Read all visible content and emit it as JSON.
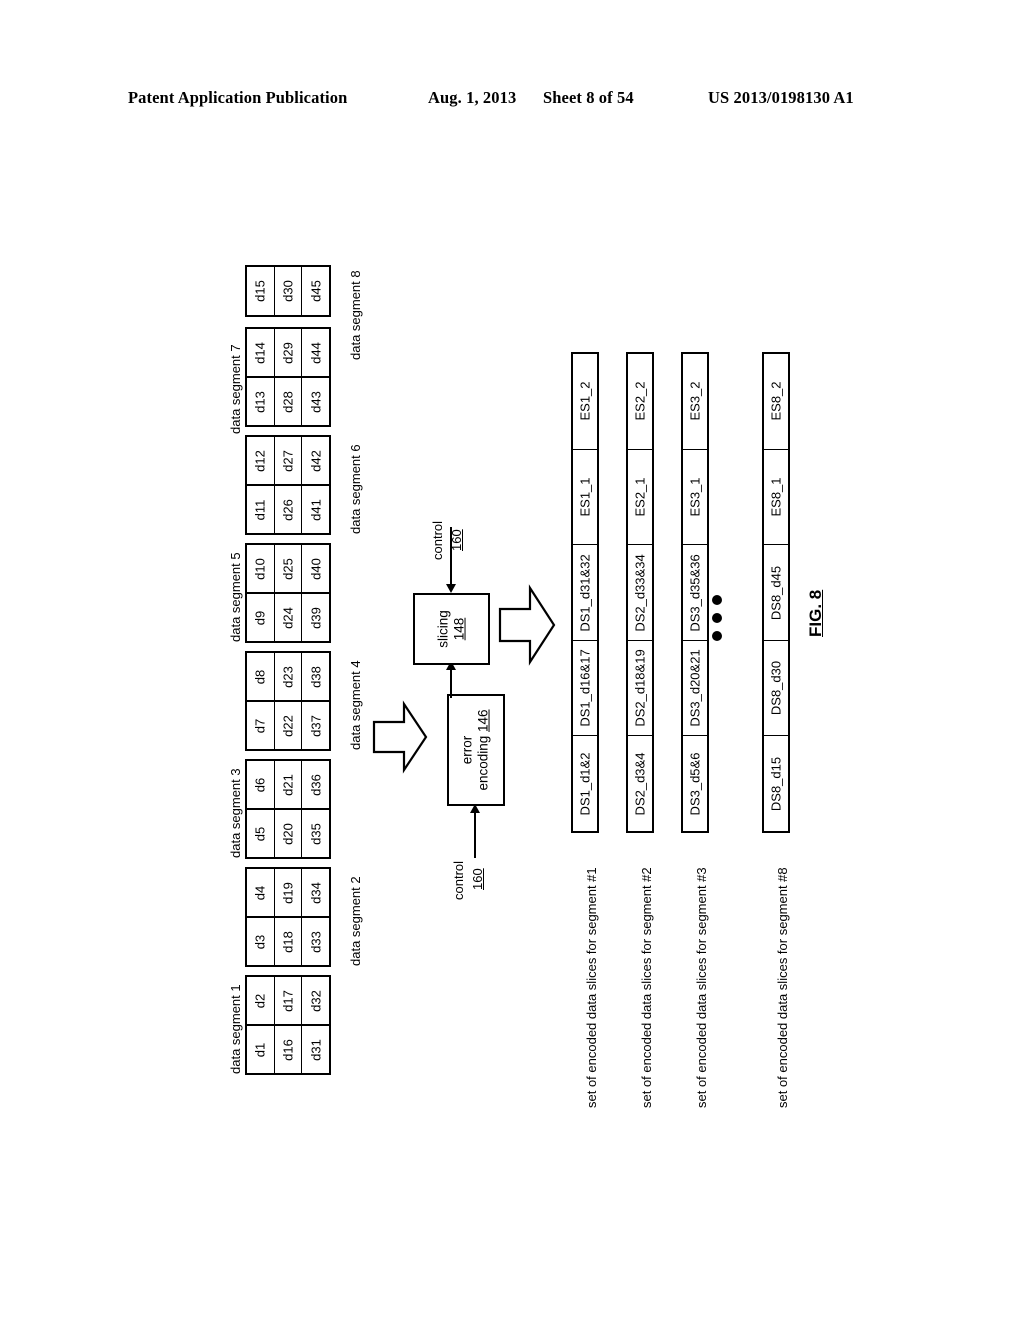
{
  "header": {
    "publication": "Patent Application Publication",
    "date": "Aug. 1, 2013",
    "sheet": "Sheet 8 of 54",
    "patent_number": "US 2013/0198130 A1"
  },
  "figure": {
    "caption": "FIG. 8"
  },
  "data_segments": [
    {
      "label": "data segment 1",
      "label_side": "left",
      "columns": [
        [
          "d1",
          "d16",
          "d31"
        ],
        [
          "d2",
          "d17",
          "d32"
        ]
      ]
    },
    {
      "label": "data segment 2",
      "label_side": "right",
      "columns": [
        [
          "d3",
          "d18",
          "d33"
        ],
        [
          "d4",
          "d19",
          "d34"
        ]
      ]
    },
    {
      "label": "data segment 3",
      "label_side": "left",
      "columns": [
        [
          "d5",
          "d20",
          "d35"
        ],
        [
          "d6",
          "d21",
          "d36"
        ]
      ]
    },
    {
      "label": "data segment 4",
      "label_side": "right",
      "columns": [
        [
          "d7",
          "d22",
          "d37"
        ],
        [
          "d8",
          "d23",
          "d38"
        ]
      ]
    },
    {
      "label": "data segment 5",
      "label_side": "left",
      "columns": [
        [
          "d9",
          "d24",
          "d39"
        ],
        [
          "d10",
          "d25",
          "d40"
        ]
      ]
    },
    {
      "label": "data segment 6",
      "label_side": "right",
      "columns": [
        [
          "d11",
          "d26",
          "d41"
        ],
        [
          "d12",
          "d27",
          "d42"
        ]
      ]
    },
    {
      "label": "data segment 7",
      "label_side": "left",
      "columns": [
        [
          "d13",
          "d28",
          "d43"
        ],
        [
          "d14",
          "d29",
          "d44"
        ]
      ]
    },
    {
      "label": "data segment 8",
      "label_side": "right",
      "columns": [
        [
          "d15",
          "d30",
          "d45"
        ]
      ]
    }
  ],
  "process": {
    "error_encoding": {
      "name": "error",
      "name2": "encoding",
      "ref": "146"
    },
    "slicing": {
      "name": "slicing",
      "ref": "148"
    },
    "control_encoding": {
      "name": "control",
      "ref": "160"
    },
    "control_slicing": {
      "name": "control",
      "ref": "160"
    }
  },
  "slice_sets": [
    {
      "label": "set of encoded data slices for segment #1",
      "cells": [
        "DS1_d1&2",
        "DS1_d16&17",
        "DS1_d31&32",
        "ES1_1",
        "ES1_2"
      ]
    },
    {
      "label": "set of encoded data slices for segment #2",
      "cells": [
        "DS2_d3&4",
        "DS2_d18&19",
        "DS2_d33&34",
        "ES2_1",
        "ES2_2"
      ]
    },
    {
      "label": "set of encoded data slices for segment #3",
      "cells": [
        "DS3_d5&6",
        "DS3_d20&21",
        "DS3_d35&36",
        "ES3_1",
        "ES3_2"
      ]
    },
    {
      "label": "set of encoded data slices for segment #8",
      "cells": [
        "DS8_d15",
        "DS8_d30",
        "DS8_d45",
        "ES8_1",
        "ES8_2"
      ]
    }
  ],
  "ellipsis": "•••"
}
